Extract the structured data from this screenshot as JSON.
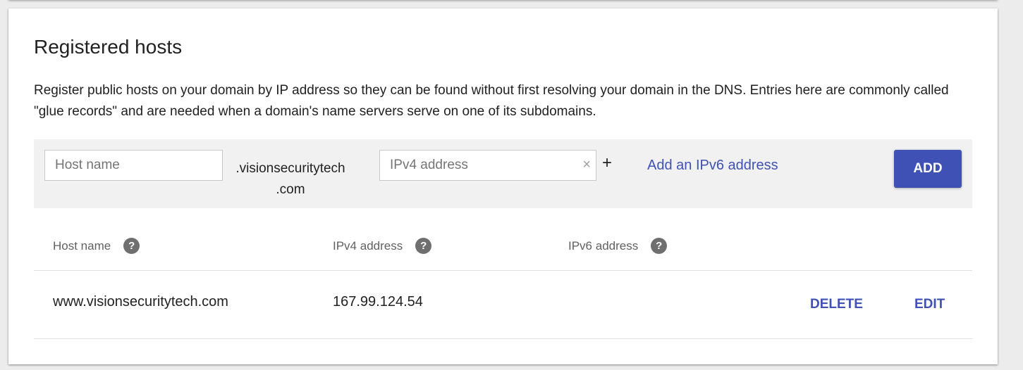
{
  "section": {
    "title": "Registered hosts",
    "description": "Register public hosts on your domain by IP address so they can be found without first resolving your domain in the DNS. Entries here are commonly called \"glue records\" and are needed when a domain's name servers serve on one of its subdomains."
  },
  "form": {
    "host_placeholder": "Host name",
    "host_value": "",
    "domain_suffix_line1": ".visionsecuritytech",
    "domain_suffix_line2": ".com",
    "ipv4_placeholder": "IPv4 address",
    "ipv4_value": "",
    "clear_glyph": "×",
    "plus_glyph": "+",
    "add_ipv6_link": "Add an IPv6 address",
    "add_button": "ADD"
  },
  "table": {
    "headers": {
      "host": "Host name",
      "ipv4": "IPv4 address",
      "ipv6": "IPv6 address",
      "help_glyph": "?"
    },
    "rows": [
      {
        "host": "www.visionsecuritytech.com",
        "ipv4": "167.99.124.54",
        "ipv6": "",
        "delete_label": "DELETE",
        "edit_label": "EDIT"
      }
    ]
  },
  "icons": {
    "clear": "close-icon",
    "plus": "plus-icon",
    "help": "help-icon"
  },
  "colors": {
    "accent": "#3f51b5",
    "form_bg": "#f1f1f1",
    "page_bg": "#ececec"
  }
}
